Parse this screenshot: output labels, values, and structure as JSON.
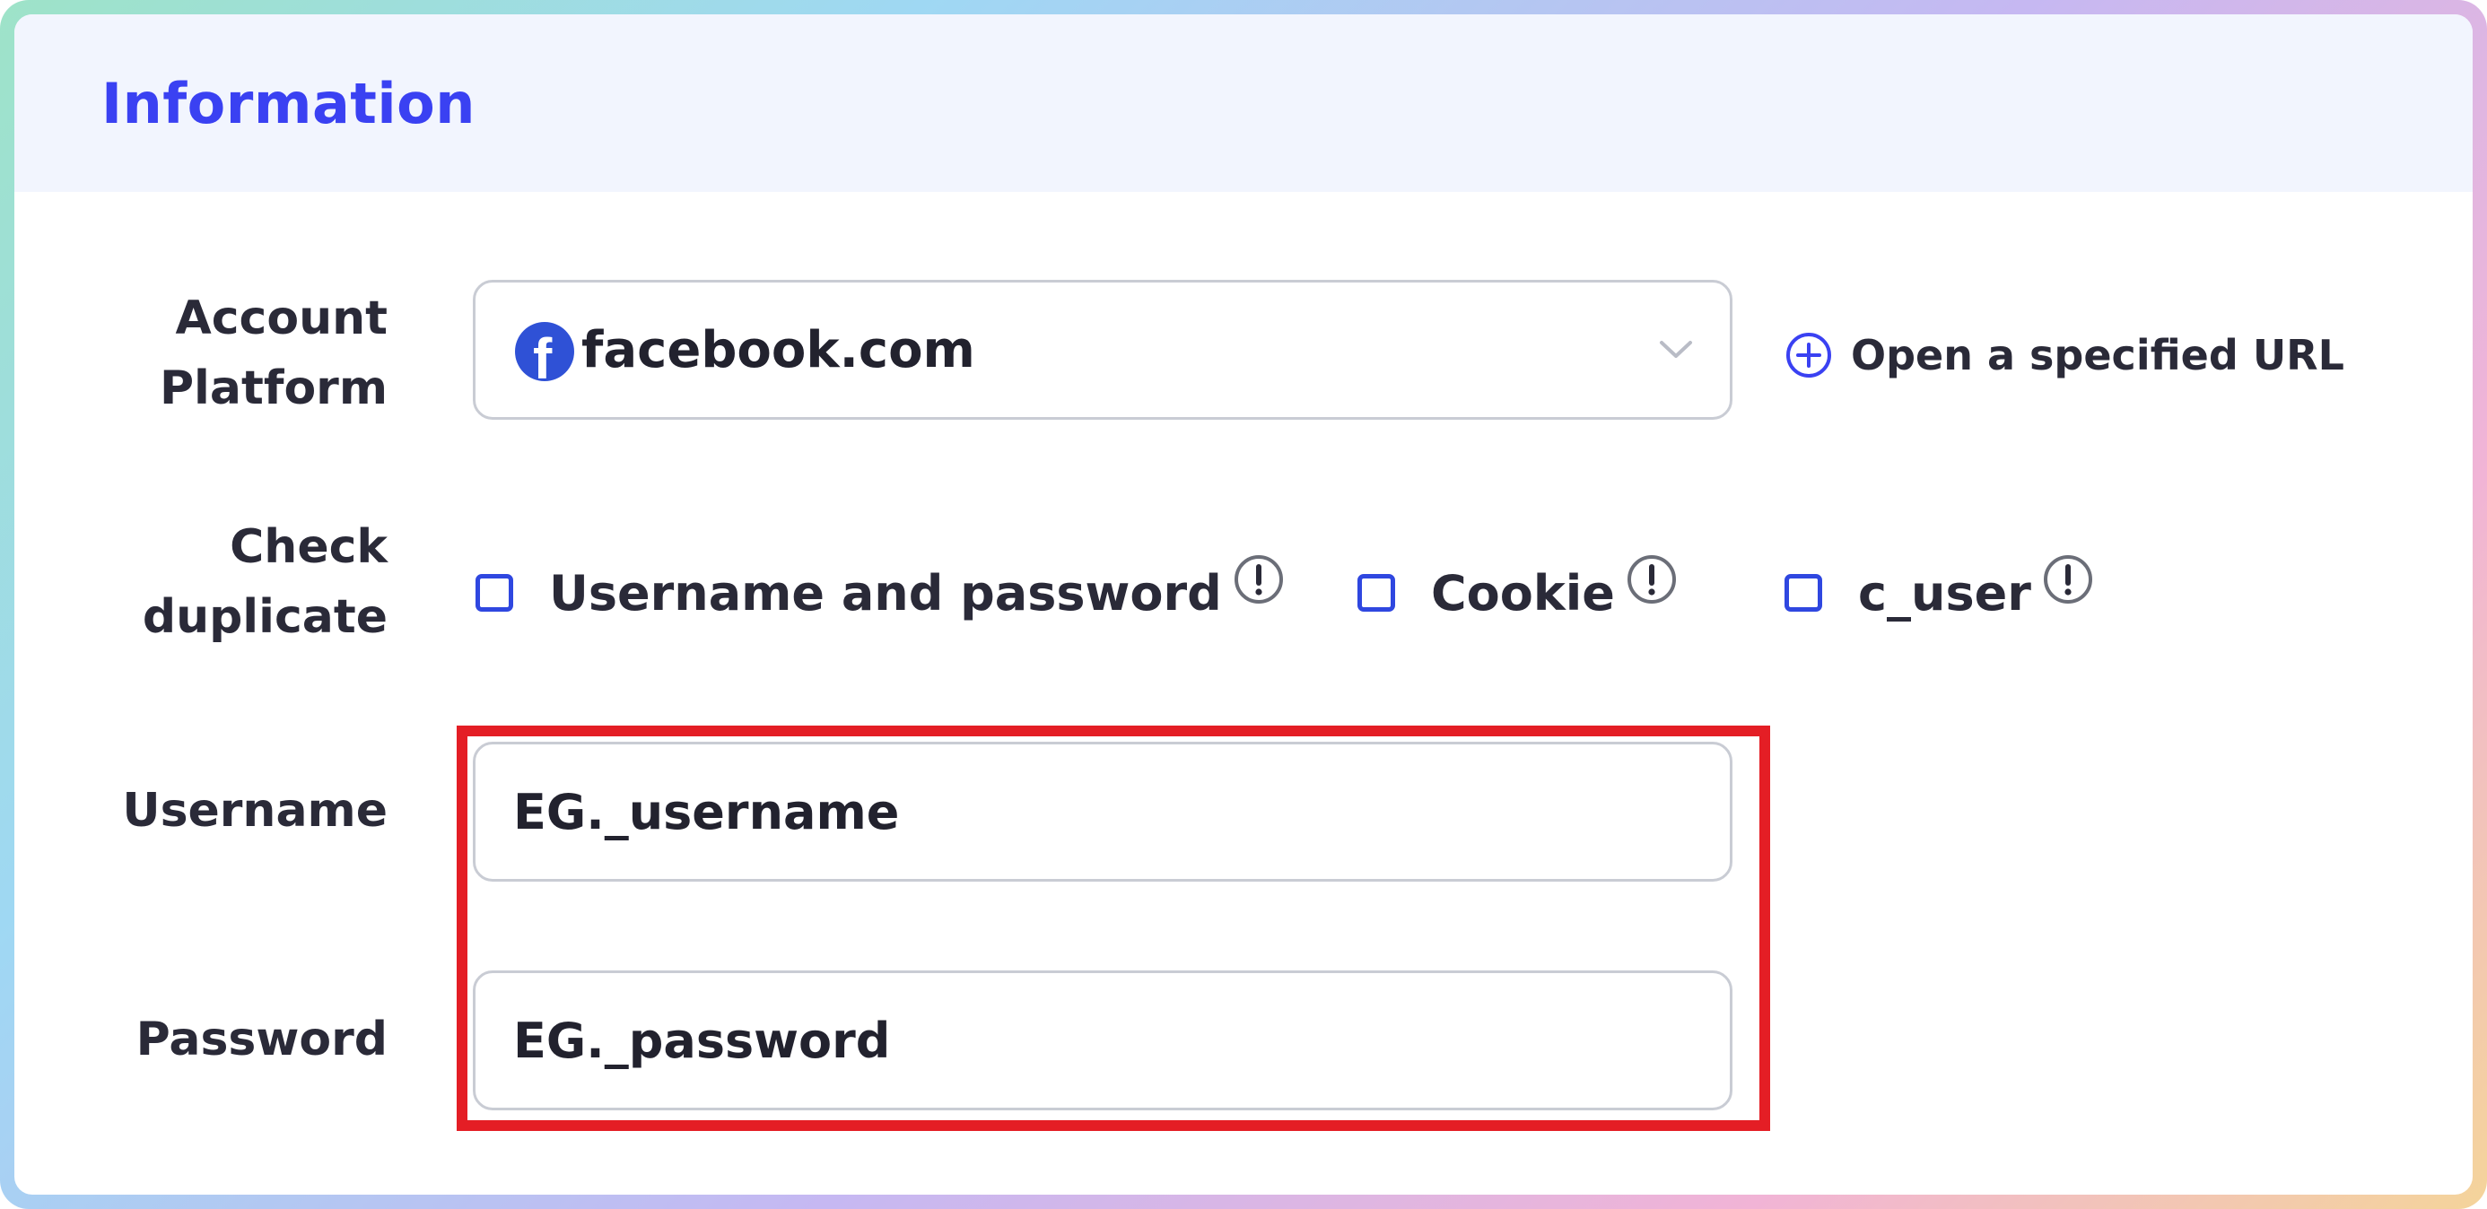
{
  "header": {
    "title": "Information"
  },
  "form": {
    "account_platform": {
      "label_line1": "Account",
      "label_line2": "Platform",
      "selected": "facebook.com",
      "open_url_label": "Open a specified URL"
    },
    "check_duplicate": {
      "label_line1": "Check",
      "label_line2": "duplicate",
      "options": [
        {
          "label": "Username and password",
          "checked": false
        },
        {
          "label": "Cookie",
          "checked": false
        },
        {
          "label": "c_user",
          "checked": false
        }
      ]
    },
    "username": {
      "label": "Username",
      "placeholder": "EG._username"
    },
    "password": {
      "label": "Password",
      "placeholder": "EG._password"
    }
  },
  "icons": {
    "platform": "facebook-icon",
    "dropdown": "chevron-down-icon",
    "add": "plus-circle-icon",
    "info": "exclamation-circle-icon"
  },
  "colors": {
    "accent": "#3a41f2",
    "checkbox": "#2f47e0",
    "highlight": "#e41e25",
    "header_bg": "#f2f5fe"
  }
}
